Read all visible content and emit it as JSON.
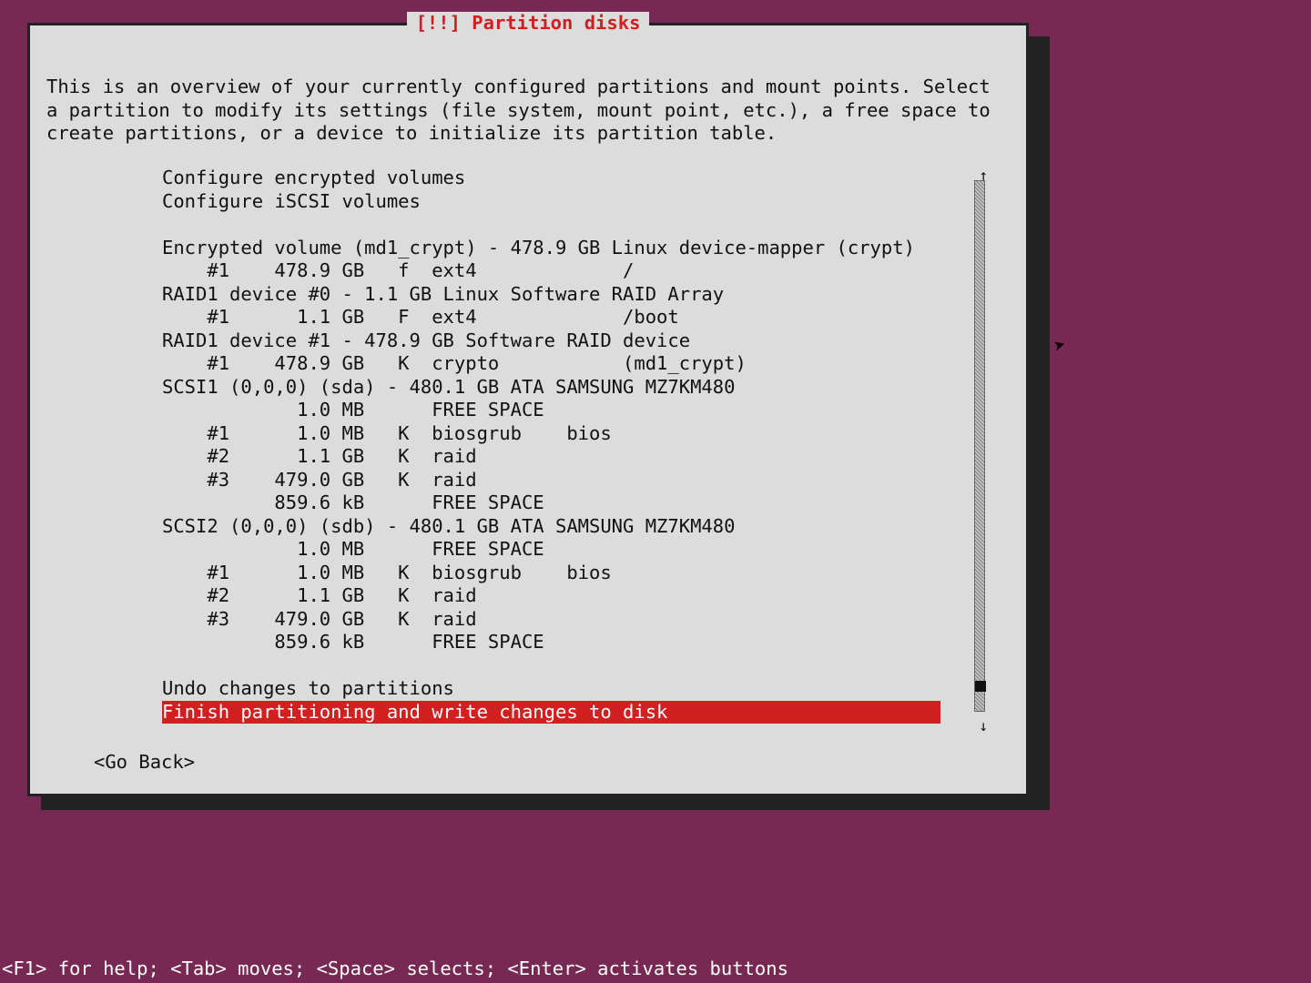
{
  "title": "[!!] Partition disks",
  "intro": "This is an overview of your currently configured partitions and mount points. Select a partition to modify its settings (file system, mount point, etc.), a free space to create partitions, or a device to initialize its partition table.",
  "rows": [
    "Configure encrypted volumes",
    "Configure iSCSI volumes",
    "",
    "Encrypted volume (md1_crypt) - 478.9 GB Linux device-mapper (crypt)",
    "    #1    478.9 GB   f  ext4             /",
    "RAID1 device #0 - 1.1 GB Linux Software RAID Array",
    "    #1      1.1 GB   F  ext4             /boot",
    "RAID1 device #1 - 478.9 GB Software RAID device",
    "    #1    478.9 GB   K  crypto           (md1_crypt)",
    "SCSI1 (0,0,0) (sda) - 480.1 GB ATA SAMSUNG MZ7KM480",
    "            1.0 MB      FREE SPACE",
    "    #1      1.0 MB   K  biosgrub    bios",
    "    #2      1.1 GB   K  raid",
    "    #3    479.0 GB   K  raid",
    "          859.6 kB      FREE SPACE",
    "SCSI2 (0,0,0) (sdb) - 480.1 GB ATA SAMSUNG MZ7KM480",
    "            1.0 MB      FREE SPACE",
    "    #1      1.0 MB   K  biosgrub    bios",
    "    #2      1.1 GB   K  raid",
    "    #3    479.0 GB   K  raid",
    "          859.6 kB      FREE SPACE",
    "",
    "Undo changes to partitions",
    "Finish partitioning and write changes to disk"
  ],
  "selected_index": 23,
  "go_back": "<Go Back>",
  "helpbar": "<F1> for help; <Tab> moves; <Space> selects; <Enter> activates buttons"
}
